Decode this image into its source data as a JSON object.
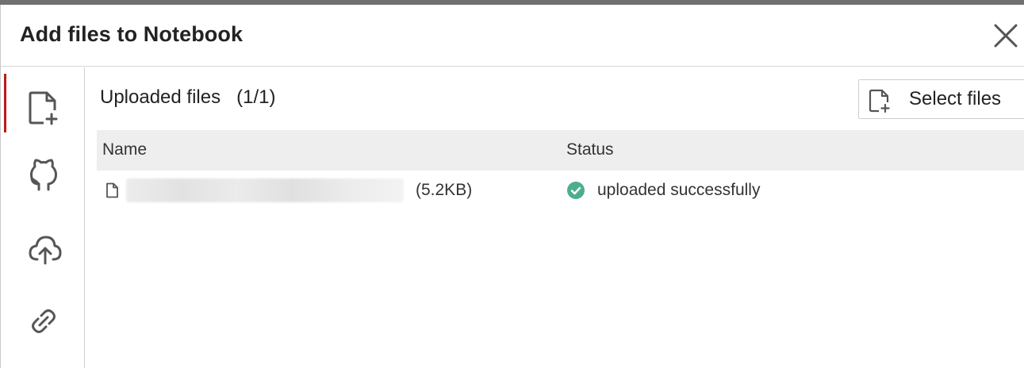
{
  "dialog": {
    "title": "Add files to Notebook"
  },
  "sidebar": {
    "items": [
      {
        "icon": "file-add-icon",
        "active": true
      },
      {
        "icon": "github-icon",
        "active": false
      },
      {
        "icon": "cloud-upload-icon",
        "active": false
      },
      {
        "icon": "link-icon",
        "active": false
      }
    ]
  },
  "main": {
    "section_title": "Uploaded files",
    "count": "(1/1)",
    "select_files_label": "Select files",
    "table": {
      "columns": [
        "Name",
        "Status"
      ],
      "rows": [
        {
          "file_size": "(5.2KB)",
          "status": "uploaded successfully"
        }
      ]
    }
  },
  "colors": {
    "accent": "#b71c1c",
    "success": "#4caf8a",
    "header_bg": "#eeeeee"
  }
}
